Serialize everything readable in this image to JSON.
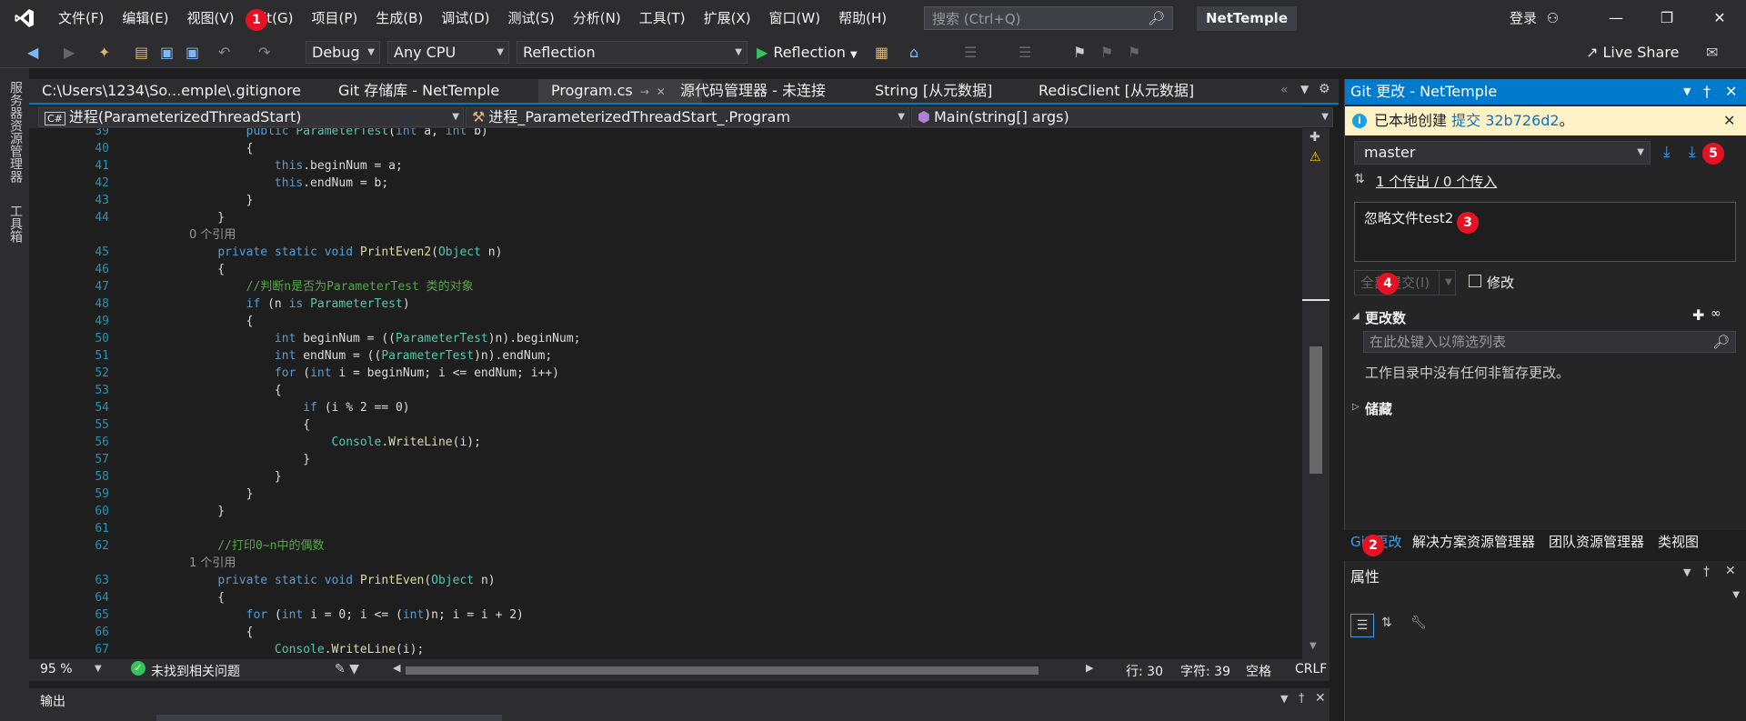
{
  "menubar": {
    "items": [
      "文件(F)",
      "编辑(E)",
      "视图(V)",
      "Git(G)",
      "项目(P)",
      "生成(B)",
      "调试(D)",
      "测试(S)",
      "分析(N)",
      "工具(T)",
      "扩展(X)",
      "窗口(W)",
      "帮助(H)"
    ],
    "search_placeholder": "搜索 (Ctrl+Q)",
    "project_title": "NetTemple",
    "login": "登录"
  },
  "toolbar": {
    "config": "Debug",
    "platform": "Any CPU",
    "startup_project": "Reflection",
    "run_label": "Reflection",
    "live_share": "Live Share"
  },
  "left_tabs": [
    "服务器资源管理器",
    "工具箱"
  ],
  "doc_tabs": [
    "C:\\Users\\1234\\So...emple\\.gitignore",
    "Git 存储库 - NetTemple",
    "Program.cs",
    "源代码管理器 - 未连接",
    "String [从元数据]",
    "RedisClient [从元数据]"
  ],
  "navbar": {
    "project": "进程(ParameterizedThreadStart)",
    "class": "进程_ParameterizedThreadStart_.Program",
    "member": "Main(string[] args)"
  },
  "code_lines": [
    {
      "n": "39",
      "t": "        public ParameterTest(int a, int b)"
    },
    {
      "n": "40",
      "t": "        {"
    },
    {
      "n": "41",
      "t": "            this.beginNum = a;"
    },
    {
      "n": "42",
      "t": "            this.endNum = b;"
    },
    {
      "n": "43",
      "t": "        }"
    },
    {
      "n": "44",
      "t": "    }"
    },
    {
      "n": "",
      "lens": "0 个引用"
    },
    {
      "n": "45",
      "t": "    private static void PrintEven2(Object n)"
    },
    {
      "n": "46",
      "t": "    {"
    },
    {
      "n": "47",
      "t": "        //判断n是否为ParameterTest 类的对象"
    },
    {
      "n": "48",
      "t": "        if (n is ParameterTest)"
    },
    {
      "n": "49",
      "t": "        {"
    },
    {
      "n": "50",
      "t": "            int beginNum = ((ParameterTest)n).beginNum;"
    },
    {
      "n": "51",
      "t": "            int endNum = ((ParameterTest)n).endNum;"
    },
    {
      "n": "52",
      "t": "            for (int i = beginNum; i <= endNum; i++)"
    },
    {
      "n": "53",
      "t": "            {"
    },
    {
      "n": "54",
      "t": "                if (i % 2 == 0)"
    },
    {
      "n": "55",
      "t": "                {"
    },
    {
      "n": "56",
      "t": "                    Console.WriteLine(i);"
    },
    {
      "n": "57",
      "t": "                }"
    },
    {
      "n": "58",
      "t": "            }"
    },
    {
      "n": "59",
      "t": "        }"
    },
    {
      "n": "60",
      "t": "    }"
    },
    {
      "n": "61",
      "t": ""
    },
    {
      "n": "62",
      "t": "    //打印0~n中的偶数"
    },
    {
      "n": "",
      "lens": "1 个引用"
    },
    {
      "n": "63",
      "t": "    private static void PrintEven(Object n)"
    },
    {
      "n": "64",
      "t": "    {"
    },
    {
      "n": "65",
      "t": "        for (int i = 0; i <= (int)n; i = i + 2)"
    },
    {
      "n": "66",
      "t": "        {"
    },
    {
      "n": "67",
      "t": "            Console.WriteLine(i);"
    }
  ],
  "status": {
    "zoom": "95 %",
    "issues": "未找到相关问题",
    "line": "行: 30",
    "col": "字符: 39",
    "ws": "空格",
    "eol": "CRLF"
  },
  "output": {
    "title": "输出"
  },
  "git_panel": {
    "title": "Git 更改 - NetTemple",
    "info_prefix": "已本地创建",
    "info_link": "提交 32b726d2",
    "info_suffix": "。",
    "branch": "master",
    "sync": "1 个传出 / 0 个传入",
    "commit_message": "忽略文件test2",
    "commit_all": "全部提交(I)",
    "amend": "修改",
    "changes_label": "更改数",
    "filter_placeholder": "在此处键入以筛选列表",
    "no_changes": "工作目录中没有任何非暂存更改。",
    "stash_label": "储藏",
    "bottom_tabs": [
      "Git 更改",
      "解决方案资源管理器",
      "团队资源管理器",
      "类视图"
    ]
  },
  "props_panel": {
    "title": "属性"
  },
  "badges": [
    "1",
    "2",
    "3",
    "4",
    "5"
  ]
}
